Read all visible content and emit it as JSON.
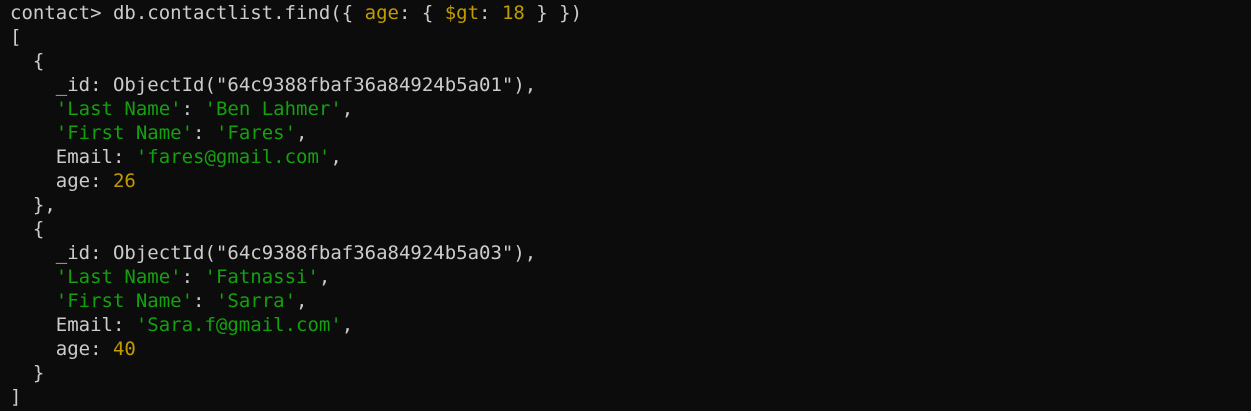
{
  "colors": {
    "background": "#0c0c0c",
    "text": "#cccccc",
    "string": "#13a10e",
    "number": "#c19c00"
  },
  "command": {
    "prompt": "contact> ",
    "part1": "db.contactlist.find({ ",
    "field": "age",
    "part2": ": { ",
    "operator": "$gt",
    "part3": ": ",
    "value": "18",
    "part4": " } })"
  },
  "output": {
    "open_bracket": "[",
    "close_bracket": "]",
    "documents": [
      {
        "id_label": "_id",
        "id_value": "ObjectId(\"64c9388fbaf36a84924b5a01\")",
        "last_name_key": "'Last Name'",
        "last_name": "'Ben Lahmer'",
        "first_name_key": "'First Name'",
        "first_name": "'Fares'",
        "email_key": "Email",
        "email": "'fares@gmail.com'",
        "age_key": "age",
        "age": "26"
      },
      {
        "id_label": "_id",
        "id_value": "ObjectId(\"64c9388fbaf36a84924b5a03\")",
        "last_name_key": "'Last Name'",
        "last_name": "'Fatnassi'",
        "first_name_key": "'First Name'",
        "first_name": "'Sarra'",
        "email_key": "Email",
        "email": "'Sara.f@gmail.com'",
        "age_key": "age",
        "age": "40"
      }
    ]
  }
}
